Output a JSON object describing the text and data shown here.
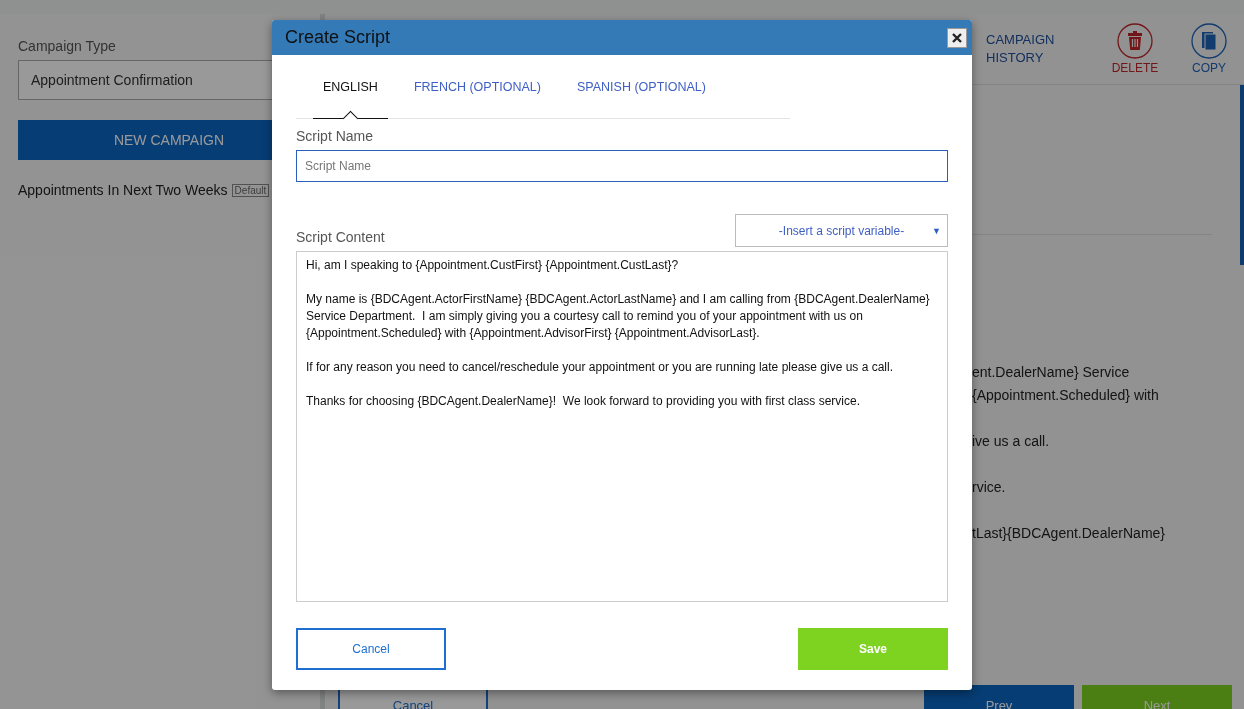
{
  "sidebar": {
    "campaign_type_label": "Campaign Type",
    "campaign_type_value": "Appointment Confirmation",
    "new_campaign_button": "NEW CAMPAIGN",
    "campaigns": [
      {
        "name": "Appointments In Next Two Weeks",
        "badge": "Default"
      }
    ]
  },
  "toolbar": {
    "items": [
      {
        "kind": "text",
        "label": "CAMPAIGN HISTORY"
      },
      {
        "kind": "delete",
        "label": "DELETE"
      },
      {
        "kind": "copy",
        "label": "COPY"
      }
    ]
  },
  "background_paragraphs": [
    [
      "ent.DealerName} Service",
      "{Appointment.Scheduled} with"
    ],
    [
      "ive us a call."
    ],
    [
      "rvice."
    ],
    [
      "tLast}{BDCAgent.DealerName}"
    ]
  ],
  "footer_buttons": [
    {
      "kind": "outline",
      "label": "Cancel"
    },
    {
      "kind": "primary",
      "label": "Prev"
    },
    {
      "kind": "success",
      "label": "Next"
    }
  ],
  "dialog": {
    "title": "Create Script",
    "tabs": [
      {
        "label": "ENGLISH",
        "selected": true
      },
      {
        "label": "FRENCH (OPTIONAL)",
        "selected": false
      },
      {
        "label": "SPANISH (OPTIONAL)",
        "selected": false
      }
    ],
    "script_name_label": "Script Name",
    "script_name_placeholder": "Script Name",
    "script_content_label": "Script Content",
    "variable_select": "-Insert a script variable-",
    "variable_select_caret": "▼",
    "script_content": [
      "Hi, am I speaking to {Appointment.CustFirst} {Appointment.CustLast}?",
      "My name is {BDCAgent.ActorFirstName} {BDCAgent.ActorLastName} and I am calling from {BDCAgent.DealerName} Service Department.  I am simply giving you a courtesy call to remind you of your appointment with us on {Appointment.Scheduled} with {Appointment.AdvisorFirst} {Appointment.AdvisorLast}.",
      "If for any reason you need to cancel/reschedule your appointment or you are running late please give us a call.",
      "Thanks for choosing {BDCAgent.DealerName}!  We look forward to providing you with first class service."
    ],
    "cancel_button": "Cancel",
    "save_button": "Save"
  }
}
